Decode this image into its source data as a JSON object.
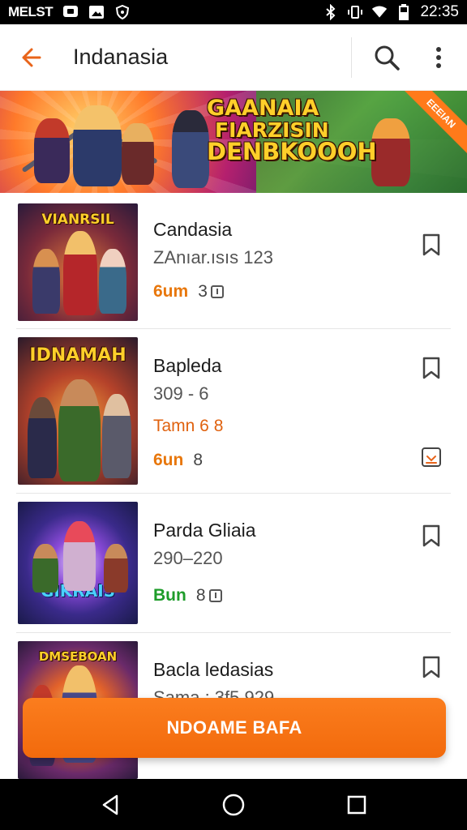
{
  "status_bar": {
    "carrier": "MELST",
    "time": "22:35",
    "left_icons": [
      "chat-icon",
      "image-icon",
      "shield-icon"
    ],
    "right_icons": [
      "bluetooth-icon",
      "vibrate-icon",
      "wifi-icon",
      "battery-icon"
    ]
  },
  "app_bar": {
    "title": "Indanasia",
    "back_icon": "arrow-left-icon",
    "search_icon": "search-icon",
    "more_icon": "more-vert-icon",
    "accent": "#e8641a"
  },
  "banner": {
    "line1": "GAANAIA",
    "line2": "FIARZISIN",
    "line3": "DENBKOOOH",
    "ribbon": "EEEIAN"
  },
  "items": [
    {
      "thumb_title": "VIANRSIL",
      "title": "Candasia",
      "subtitle": "ZAnıar.ısıs 123",
      "extra": "",
      "price": "6um",
      "price_color": "#e8770c",
      "count": "3",
      "has_download": false
    },
    {
      "thumb_title": "IDNAMAH",
      "title": "Bapleda",
      "subtitle": "309 - 6",
      "extra": "Tamn 6 8",
      "price": "6un",
      "price_color": "#e8770c",
      "count": "8",
      "has_download": true
    },
    {
      "thumb_title": "GIKRAIS",
      "title": "Parda Gliaia",
      "subtitle": "290–220",
      "extra": "",
      "price": "Bun",
      "price_color": "#1e9c2a",
      "count": "8",
      "has_download": false
    },
    {
      "thumb_title": "DMSEBOAN",
      "title": "Bacla ledasias",
      "subtitle": "Sama : 3f5 929",
      "extra": "",
      "price": "",
      "price_color": "#1e9c2a",
      "count": "",
      "has_download": false
    }
  ],
  "cta": {
    "label": "NDOAME BAFA",
    "color": "#f7741a"
  },
  "nav_bar": {
    "icons": [
      "back-triangle-icon",
      "home-circle-icon",
      "recents-square-icon"
    ]
  }
}
